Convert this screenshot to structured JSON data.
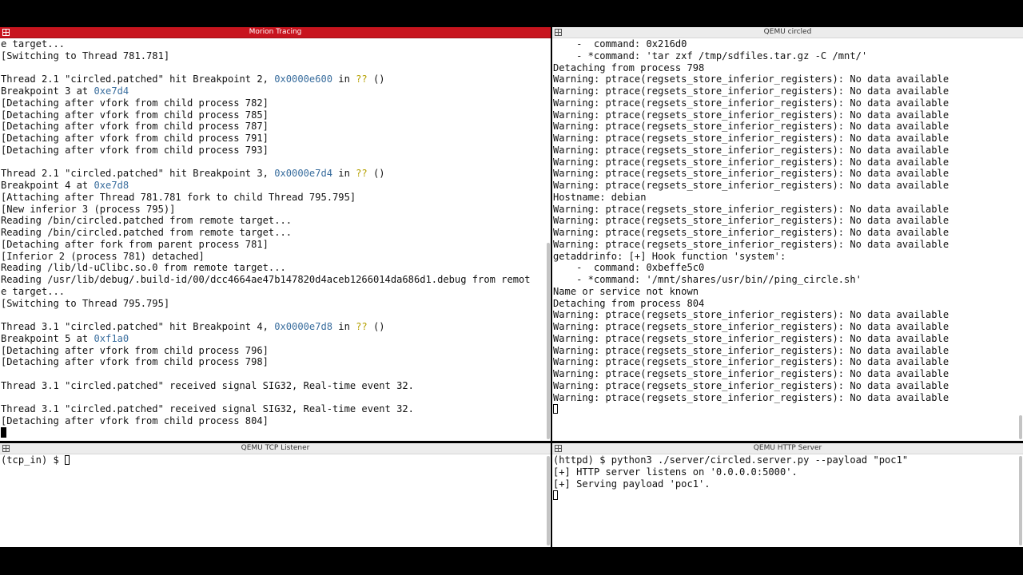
{
  "panes": {
    "tracing": {
      "title": "Morion Tracing",
      "lines": [
        "e target...",
        "[Switching to Thread 781.781]",
        "",
        "Thread 2.1 \"circled.patched\" hit Breakpoint 2, {{0x0000e600}} in {{??}} ()",
        "Breakpoint 3 at {{0xe7d4}}",
        "[Detaching after vfork from child process 782]",
        "[Detaching after vfork from child process 785]",
        "[Detaching after vfork from child process 787]",
        "[Detaching after vfork from child process 791]",
        "[Detaching after vfork from child process 793]",
        "",
        "Thread 2.1 \"circled.patched\" hit Breakpoint 3, {{0x0000e7d4}} in {{??}} ()",
        "Breakpoint 4 at {{0xe7d8}}",
        "[Attaching after Thread 781.781 fork to child Thread 795.795]",
        "[New inferior 3 (process 795)]",
        "Reading /bin/circled.patched from remote target...",
        "Reading /bin/circled.patched from remote target...",
        "[Detaching after fork from parent process 781]",
        "[Inferior 2 (process 781) detached]",
        "Reading /lib/ld-uClibc.so.0 from remote target...",
        "Reading /usr/lib/debug/.build-id/00/dcc4664ae47b147820d4aceb1266014da686d1.debug from remot",
        "e target...",
        "[Switching to Thread 795.795]",
        "",
        "Thread 3.1 \"circled.patched\" hit Breakpoint 4, {{0x0000e7d8}} in {{??}} ()",
        "Breakpoint 5 at {{0xf1a0}}",
        "[Detaching after vfork from child process 796]",
        "[Detaching after vfork from child process 798]",
        "",
        "Thread 3.1 \"circled.patched\" received signal SIG32, Real-time event 32.",
        "",
        "Thread 3.1 \"circled.patched\" received signal SIG32, Real-time event 32.",
        "[Detaching after vfork from child process 804]"
      ]
    },
    "circled": {
      "title": "QEMU circled",
      "lines": [
        "    -  command: 0x216d0",
        "    - *command: 'tar zxf /tmp/sdfiles.tar.gz -C /mnt/'",
        "Detaching from process 798",
        "Warning: ptrace(regsets_store_inferior_registers): No data available",
        "Warning: ptrace(regsets_store_inferior_registers): No data available",
        "Warning: ptrace(regsets_store_inferior_registers): No data available",
        "Warning: ptrace(regsets_store_inferior_registers): No data available",
        "Warning: ptrace(regsets_store_inferior_registers): No data available",
        "Warning: ptrace(regsets_store_inferior_registers): No data available",
        "Warning: ptrace(regsets_store_inferior_registers): No data available",
        "Warning: ptrace(regsets_store_inferior_registers): No data available",
        "Warning: ptrace(regsets_store_inferior_registers): No data available",
        "Warning: ptrace(regsets_store_inferior_registers): No data available",
        "Hostname: debian",
        "Warning: ptrace(regsets_store_inferior_registers): No data available",
        "Warning: ptrace(regsets_store_inferior_registers): No data available",
        "Warning: ptrace(regsets_store_inferior_registers): No data available",
        "Warning: ptrace(regsets_store_inferior_registers): No data available",
        "getaddrinfo: [+] Hook function 'system':",
        "    -  command: 0xbeffe5c0",
        "    - *command: '/mnt/shares/usr/bin//ping_circle.sh'",
        "Name or service not known",
        "Detaching from process 804",
        "Warning: ptrace(regsets_store_inferior_registers): No data available",
        "Warning: ptrace(regsets_store_inferior_registers): No data available",
        "Warning: ptrace(regsets_store_inferior_registers): No data available",
        "Warning: ptrace(regsets_store_inferior_registers): No data available",
        "Warning: ptrace(regsets_store_inferior_registers): No data available",
        "Warning: ptrace(regsets_store_inferior_registers): No data available",
        "Warning: ptrace(regsets_store_inferior_registers): No data available",
        "Warning: ptrace(regsets_store_inferior_registers): No data available"
      ]
    },
    "tcp": {
      "title": "QEMU TCP Listener",
      "prompt": "(tcp_in) $ "
    },
    "http": {
      "title": "QEMU HTTP Server",
      "lines": [
        "(httpd) $ python3 ./server/circled.server.py --payload \"poc1\"",
        "[+] HTTP server listens on '0.0.0.0:5000'.",
        "[+] Serving payload 'poc1'."
      ]
    }
  },
  "colors": {
    "active_title_bg": "#c8141e",
    "address": "#3a6e9e",
    "unknown_symbol": "#b5a000"
  }
}
